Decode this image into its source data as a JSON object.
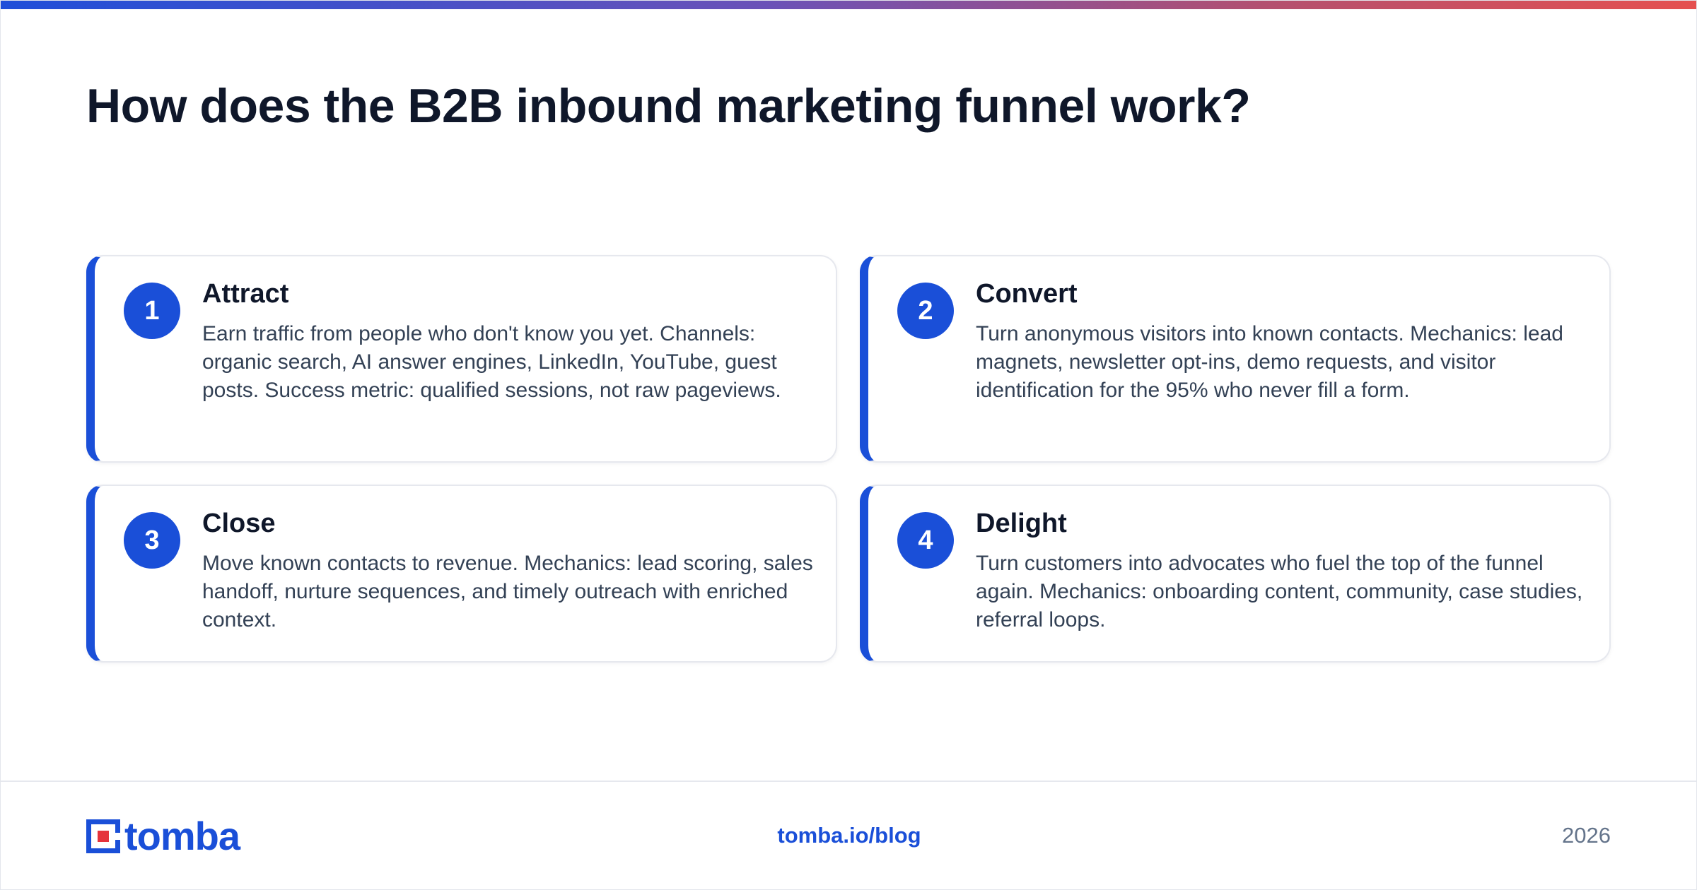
{
  "header": {
    "title": "How does the B2B inbound marketing funnel work?"
  },
  "cards": [
    {
      "number": "1",
      "title": "Attract",
      "body": "Earn traffic from people who don't know you yet. Channels: organic search, AI answer engines, LinkedIn, YouTube, guest posts. Success metric: qualified sessions, not raw pageviews."
    },
    {
      "number": "2",
      "title": "Convert",
      "body": "Turn anonymous visitors into known contacts. Mechanics: lead magnets, newsletter opt-ins, demo requests, and visitor identification for the 95% who never fill a form."
    },
    {
      "number": "3",
      "title": "Close",
      "body": "Move known contacts to revenue. Mechanics: lead scoring, sales handoff, nurture sequences, and timely outreach with enriched context."
    },
    {
      "number": "4",
      "title": "Delight",
      "body": "Turn customers into advocates who fuel the top of the funnel again. Mechanics: onboarding content, community, case studies, referral loops."
    }
  ],
  "footer": {
    "logo_text": "tomba",
    "link": "tomba.io/blog",
    "year": "2026"
  },
  "colors": {
    "accent": "#1a4fd8",
    "logo_red": "#e5333b",
    "title": "#0f172a",
    "body_text": "#334155",
    "gradient_start": "#1f4fd9",
    "gradient_end": "#e5504f"
  },
  "icons": {
    "logo": "tomba-logo-mark"
  }
}
